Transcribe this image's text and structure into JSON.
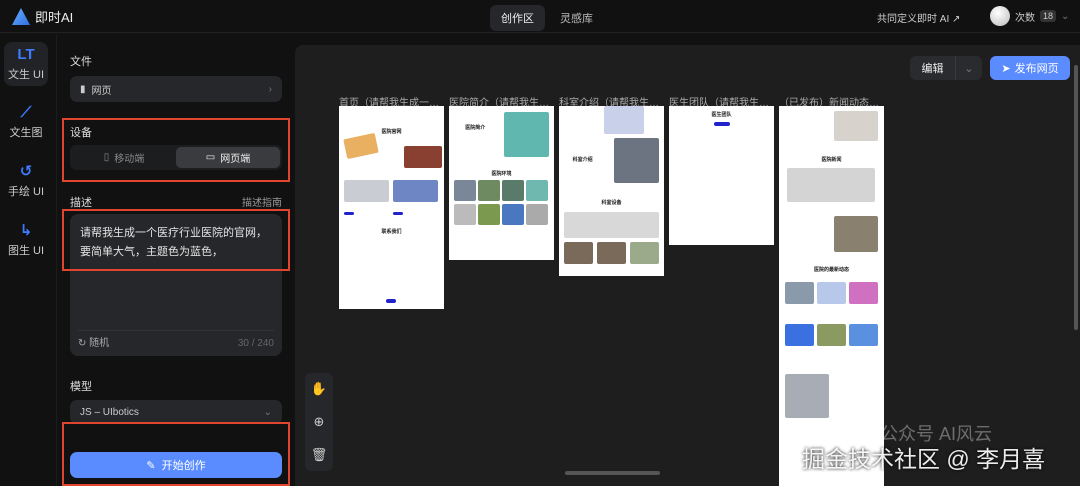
{
  "app": {
    "name": "即时AI"
  },
  "nav": {
    "tabs": [
      {
        "label": "创作区"
      },
      {
        "label": "灵感库"
      }
    ],
    "cocreate": "共同定义即时 AI ↗",
    "credits_label": "次数",
    "credits": "18"
  },
  "rail": [
    {
      "label": "文生 UI",
      "icon": "LT"
    },
    {
      "label": "文生图",
      "icon": "⟋"
    },
    {
      "label": "手绘 UI",
      "icon": "↺"
    },
    {
      "label": "图生 UI",
      "icon": "↳"
    }
  ],
  "panel": {
    "file_label": "文件",
    "file_value": "网页",
    "device_label": "设备",
    "device_options": [
      "移动端",
      "网页端"
    ],
    "desc_label": "描述",
    "desc_guide": "描述指南",
    "desc_value": "请帮我生成一个医疗行业医院的官网，要简单大气，主题色为蓝色，",
    "random_label": "随机",
    "char_count": "30 / 240",
    "model_label": "模型",
    "model_value": "JS – UIbotics",
    "start_label": "开始创作"
  },
  "canvas": {
    "edit_label": "编辑",
    "publish_label": "发布网页",
    "pages": [
      {
        "title": "首页（请帮我生成一…",
        "heading": "医院官网",
        "sub": "联系我们"
      },
      {
        "title": "医院简介（请帮我生…",
        "heading": "医院简介",
        "sub": "医院环境"
      },
      {
        "title": "科室介绍（请帮我生…",
        "heading": "科室介绍",
        "sub": "科室设备"
      },
      {
        "title": "医生团队（请帮我生…",
        "heading": "医生团队",
        "sub": ""
      },
      {
        "title": "（已发布）新闻动态…",
        "heading": "医院新闻",
        "sub": "医院的最新动态"
      }
    ]
  },
  "watermark": {
    "main": "掘金技术社区 @ 李月喜",
    "secondary": "公众号 AI风云"
  }
}
